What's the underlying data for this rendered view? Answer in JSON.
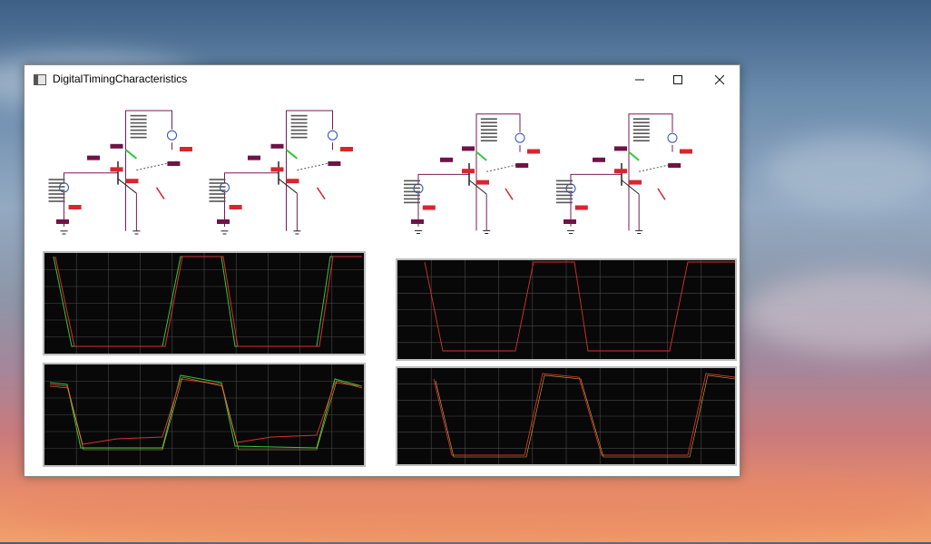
{
  "window": {
    "title": "DigitalTimingCharacteristics",
    "controls": {
      "minimize": "—",
      "maximize": "☐",
      "close": "✕"
    }
  },
  "icons": [
    "app-icon",
    "minimize-icon",
    "maximize-icon",
    "close-icon"
  ],
  "colors": {
    "trace_red": "#d93030",
    "trace_green": "#32c83a",
    "trace_yellow": "#d6b23a",
    "grid": "#4a4a4a",
    "component_label": "#6e1446",
    "component_label_red": "#d7262f",
    "wire": "#7a1b58"
  },
  "circuits": [
    {
      "name": "circuit-1"
    },
    {
      "name": "circuit-2"
    },
    {
      "name": "circuit-3"
    },
    {
      "name": "circuit-4"
    }
  ],
  "scopes": [
    {
      "name": "scope-top-left"
    },
    {
      "name": "scope-bottom-left"
    },
    {
      "name": "scope-top-right"
    },
    {
      "name": "scope-bottom-right"
    }
  ]
}
